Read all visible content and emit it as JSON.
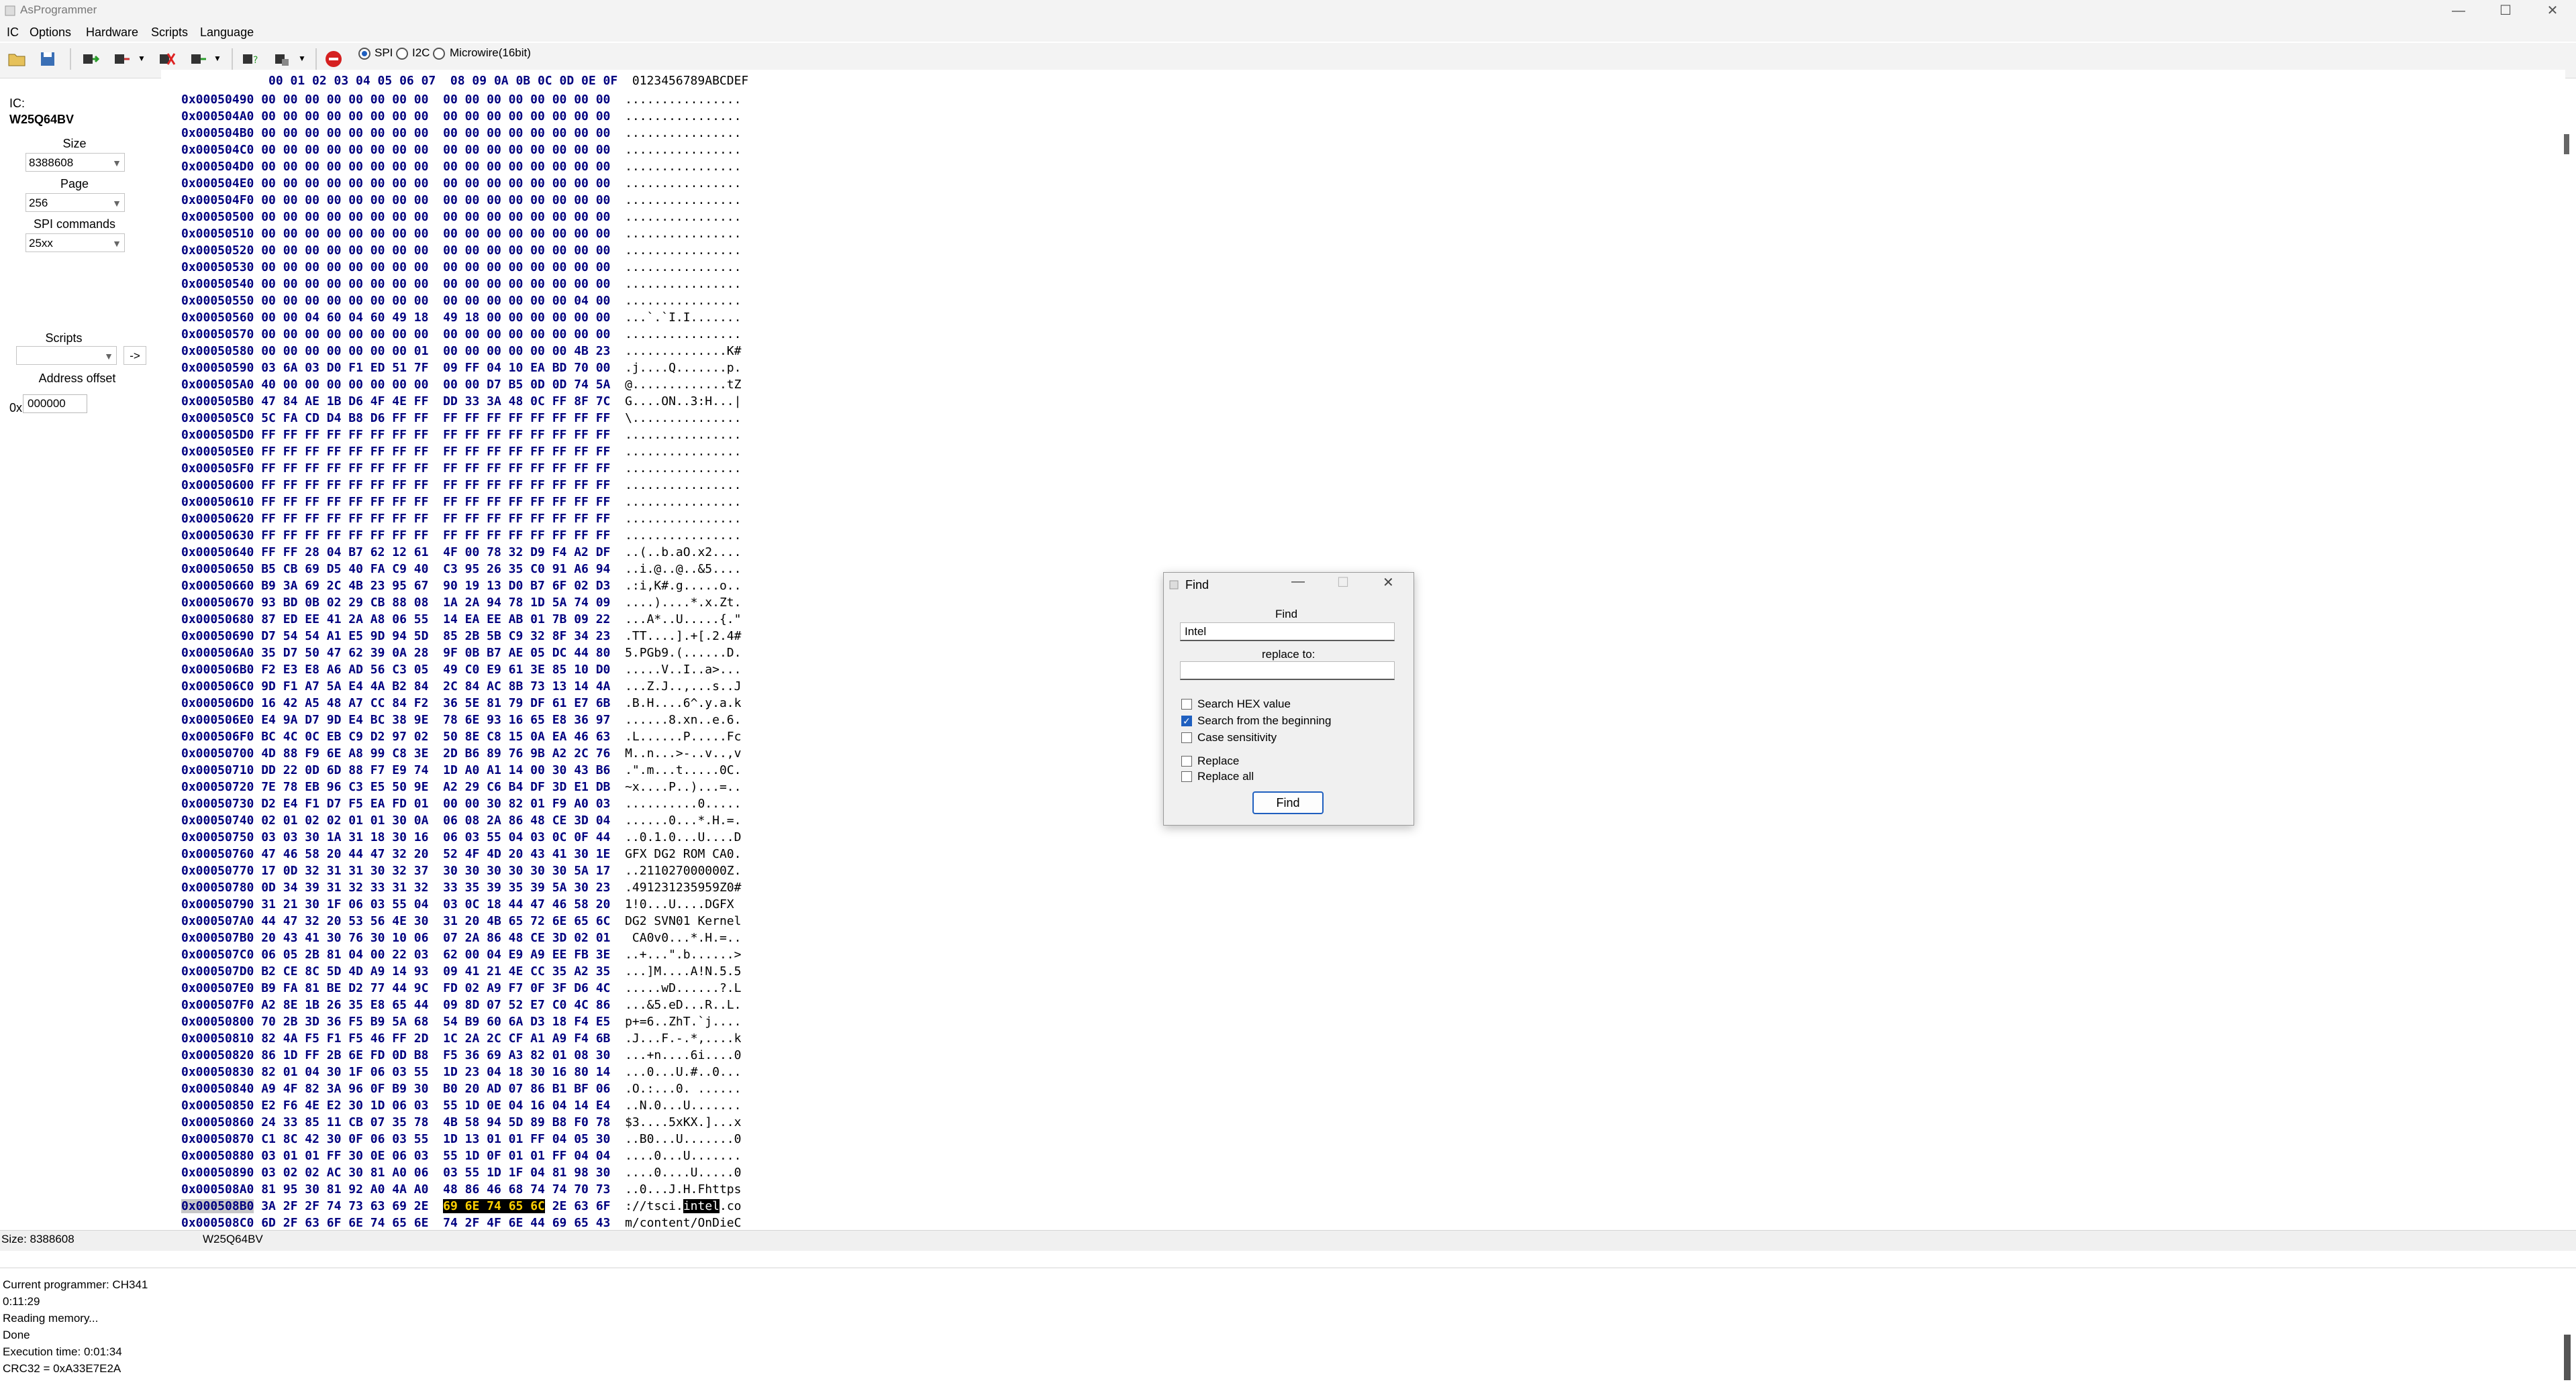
{
  "window": {
    "title": "AsProgrammer",
    "min": "—",
    "max": "☐",
    "close": "✕"
  },
  "menu": [
    "IC",
    "Options",
    "Hardware",
    "Scripts",
    "Language"
  ],
  "toolbar": {
    "protocols": [
      "SPI",
      "I2C",
      "Microwire(16bit)"
    ],
    "selected_protocol": "SPI"
  },
  "left_panel": {
    "ic_label": "IC:",
    "ic_name": "W25Q64BV",
    "size_label": "Size",
    "size_value": "8388608",
    "page_label": "Page",
    "page_value": "256",
    "spi_label": "SPI commands",
    "spi_value": "25xx",
    "scripts_label": "Scripts",
    "scripts_value": "",
    "run_label": "->",
    "addr_label": "Address offset",
    "addr_prefix": "0x",
    "addr_value": "000000"
  },
  "hex": {
    "header": "00 01 02 03 04 05 06 07  08 09 0A 0B 0C 0D 0E 0F",
    "ascii_header": "0123456789ABCDEF",
    "rows": [
      {
        "a": "0x00050490",
        "b": "00 00 00 00 00 00 00 00  00 00 00 00 00 00 00 00",
        "t": "................"
      },
      {
        "a": "0x000504A0",
        "b": "00 00 00 00 00 00 00 00  00 00 00 00 00 00 00 00",
        "t": "................"
      },
      {
        "a": "0x000504B0",
        "b": "00 00 00 00 00 00 00 00  00 00 00 00 00 00 00 00",
        "t": "................"
      },
      {
        "a": "0x000504C0",
        "b": "00 00 00 00 00 00 00 00  00 00 00 00 00 00 00 00",
        "t": "................"
      },
      {
        "a": "0x000504D0",
        "b": "00 00 00 00 00 00 00 00  00 00 00 00 00 00 00 00",
        "t": "................"
      },
      {
        "a": "0x000504E0",
        "b": "00 00 00 00 00 00 00 00  00 00 00 00 00 00 00 00",
        "t": "................"
      },
      {
        "a": "0x000504F0",
        "b": "00 00 00 00 00 00 00 00  00 00 00 00 00 00 00 00",
        "t": "................"
      },
      {
        "a": "0x00050500",
        "b": "00 00 00 00 00 00 00 00  00 00 00 00 00 00 00 00",
        "t": "................"
      },
      {
        "a": "0x00050510",
        "b": "00 00 00 00 00 00 00 00  00 00 00 00 00 00 00 00",
        "t": "................"
      },
      {
        "a": "0x00050520",
        "b": "00 00 00 00 00 00 00 00  00 00 00 00 00 00 00 00",
        "t": "................"
      },
      {
        "a": "0x00050530",
        "b": "00 00 00 00 00 00 00 00  00 00 00 00 00 00 00 00",
        "t": "................"
      },
      {
        "a": "0x00050540",
        "b": "00 00 00 00 00 00 00 00  00 00 00 00 00 00 00 00",
        "t": "................"
      },
      {
        "a": "0x00050550",
        "b": "00 00 00 00 00 00 00 00  00 00 00 00 00 00 04 00",
        "t": "................"
      },
      {
        "a": "0x00050560",
        "b": "00 00 04 60 04 60 49 18  49 18 00 00 00 00 00 00",
        "t": "...`.`I.I......."
      },
      {
        "a": "0x00050570",
        "b": "00 00 00 00 00 00 00 00  00 00 00 00 00 00 00 00",
        "t": "................"
      },
      {
        "a": "0x00050580",
        "b": "00 00 00 00 00 00 00 01  00 00 00 00 00 00 4B 23",
        "t": "..............K#"
      },
      {
        "a": "0x00050590",
        "b": "03 6A 03 D0 F1 ED 51 7F  09 FF 04 10 EA BD 70 00",
        "t": ".j....Q.......p."
      },
      {
        "a": "0x000505A0",
        "b": "40 00 00 00 00 00 00 00  00 00 D7 B5 0D 0D 74 5A",
        "t": "@.............tZ"
      },
      {
        "a": "0x000505B0",
        "b": "47 84 AE 1B D6 4F 4E FF  DD 33 3A 48 0C FF 8F 7C",
        "t": "G....ON..3:H...|"
      },
      {
        "a": "0x000505C0",
        "b": "5C FA CD D4 B8 D6 FF FF  FF FF FF FF FF FF FF FF",
        "t": "\\..............."
      },
      {
        "a": "0x000505D0",
        "b": "FF FF FF FF FF FF FF FF  FF FF FF FF FF FF FF FF",
        "t": "................"
      },
      {
        "a": "0x000505E0",
        "b": "FF FF FF FF FF FF FF FF  FF FF FF FF FF FF FF FF",
        "t": "................"
      },
      {
        "a": "0x000505F0",
        "b": "FF FF FF FF FF FF FF FF  FF FF FF FF FF FF FF FF",
        "t": "................"
      },
      {
        "a": "0x00050600",
        "b": "FF FF FF FF FF FF FF FF  FF FF FF FF FF FF FF FF",
        "t": "................"
      },
      {
        "a": "0x00050610",
        "b": "FF FF FF FF FF FF FF FF  FF FF FF FF FF FF FF FF",
        "t": "................"
      },
      {
        "a": "0x00050620",
        "b": "FF FF FF FF FF FF FF FF  FF FF FF FF FF FF FF FF",
        "t": "................"
      },
      {
        "a": "0x00050630",
        "b": "FF FF FF FF FF FF FF FF  FF FF FF FF FF FF FF FF",
        "t": "................"
      },
      {
        "a": "0x00050640",
        "b": "FF FF 28 04 B7 62 12 61  4F 00 78 32 D9 F4 A2 DF",
        "t": "..(..b.aO.x2...."
      },
      {
        "a": "0x00050650",
        "b": "B5 CB 69 D5 40 FA C9 40  C3 95 26 35 C0 91 A6 94",
        "t": "..i.@..@..&5...."
      },
      {
        "a": "0x00050660",
        "b": "B9 3A 69 2C 4B 23 95 67  90 19 13 D0 B7 6F 02 D3",
        "t": ".:i,K#.g.....o.."
      },
      {
        "a": "0x00050670",
        "b": "93 BD 0B 02 29 CB 88 08  1A 2A 94 78 1D 5A 74 09",
        "t": "....)....*.x.Zt."
      },
      {
        "a": "0x00050680",
        "b": "87 ED EE 41 2A A8 06 55  14 EA EE AB 01 7B 09 22",
        "t": "...A*..U.....{.\""
      },
      {
        "a": "0x00050690",
        "b": "D7 54 54 A1 E5 9D 94 5D  85 2B 5B C9 32 8F 34 23",
        "t": ".TT....].+[.2.4#"
      },
      {
        "a": "0x000506A0",
        "b": "35 D7 50 47 62 39 0A 28  9F 0B B7 AE 05 DC 44 80",
        "t": "5.PGb9.(......D."
      },
      {
        "a": "0x000506B0",
        "b": "F2 E3 E8 A6 AD 56 C3 05  49 C0 E9 61 3E 85 10 D0",
        "t": ".....V..I..a>..."
      },
      {
        "a": "0x000506C0",
        "b": "9D F1 A7 5A E4 4A B2 84  2C 84 AC 8B 73 13 14 4A",
        "t": "...Z.J..,...s..J"
      },
      {
        "a": "0x000506D0",
        "b": "16 42 A5 48 A7 CC 84 F2  36 5E 81 79 DF 61 E7 6B",
        "t": ".B.H....6^.y.a.k"
      },
      {
        "a": "0x000506E0",
        "b": "E4 9A D7 9D E4 BC 38 9E  78 6E 93 16 65 E8 36 97",
        "t": "......8.xn..e.6."
      },
      {
        "a": "0x000506F0",
        "b": "BC 4C 0C EB C9 D2 97 02  50 8E C8 15 0A EA 46 63",
        "t": ".L......P.....Fc"
      },
      {
        "a": "0x00050700",
        "b": "4D 88 F9 6E A8 99 C8 3E  2D B6 89 76 9B A2 2C 76",
        "t": "M..n...>-..v..,v"
      },
      {
        "a": "0x00050710",
        "b": "DD 22 0D 6D 88 F7 E9 74  1D A0 A1 14 00 30 43 B6",
        "t": ".\".m...t.....0C."
      },
      {
        "a": "0x00050720",
        "b": "7E 78 EB 96 C3 E5 50 9E  A2 29 C6 B4 DF 3D E1 DB",
        "t": "~x....P..)...=.."
      },
      {
        "a": "0x00050730",
        "b": "D2 E4 F1 D7 F5 EA FD 01  00 00 30 82 01 F9 A0 03",
        "t": "..........0....."
      },
      {
        "a": "0x00050740",
        "b": "02 01 02 02 01 01 30 0A  06 08 2A 86 48 CE 3D 04",
        "t": "......0...*.H.=."
      },
      {
        "a": "0x00050750",
        "b": "03 03 30 1A 31 18 30 16  06 03 55 04 03 0C 0F 44",
        "t": "..0.1.0...U....D"
      },
      {
        "a": "0x00050760",
        "b": "47 46 58 20 44 47 32 20  52 4F 4D 20 43 41 30 1E",
        "t": "GFX DG2 ROM CA0."
      },
      {
        "a": "0x00050770",
        "b": "17 0D 32 31 31 30 32 37  30 30 30 30 30 30 5A 17",
        "t": "..211027000000Z."
      },
      {
        "a": "0x00050780",
        "b": "0D 34 39 31 32 33 31 32  33 35 39 35 39 5A 30 23",
        "t": ".491231235959Z0#"
      },
      {
        "a": "0x00050790",
        "b": "31 21 30 1F 06 03 55 04  03 0C 18 44 47 46 58 20",
        "t": "1!0...U....DGFX "
      },
      {
        "a": "0x000507A0",
        "b": "44 47 32 20 53 56 4E 30  31 20 4B 65 72 6E 65 6C",
        "t": "DG2 SVN01 Kernel"
      },
      {
        "a": "0x000507B0",
        "b": "20 43 41 30 76 30 10 06  07 2A 86 48 CE 3D 02 01",
        "t": " CA0v0...*.H.=.."
      },
      {
        "a": "0x000507C0",
        "b": "06 05 2B 81 04 00 22 03  62 00 04 E9 A9 EE FB 3E",
        "t": "..+...\".b......>"
      },
      {
        "a": "0x000507D0",
        "b": "B2 CE 8C 5D 4D A9 14 93  09 41 21 4E CC 35 A2 35",
        "t": "...]M....A!N.5.5"
      },
      {
        "a": "0x000507E0",
        "b": "B9 FA 81 BE D2 77 44 9C  FD 02 A9 F7 0F 3F D6 4C",
        "t": ".....wD......?.L"
      },
      {
        "a": "0x000507F0",
        "b": "A2 8E 1B 26 35 E8 65 44  09 8D 07 52 E7 C0 4C 86",
        "t": "...&5.eD...R..L."
      },
      {
        "a": "0x00050800",
        "b": "70 2B 3D 36 F5 B9 5A 68  54 B9 60 6A D3 18 F4 E5",
        "t": "p+=6..ZhT.`j...."
      },
      {
        "a": "0x00050810",
        "b": "82 4A F5 F1 F5 46 FF 2D  1C 2A 2C CF A1 A9 F4 6B",
        "t": ".J...F.-.*,....k"
      },
      {
        "a": "0x00050820",
        "b": "86 1D FF 2B 6E FD 0D B8  F5 36 69 A3 82 01 08 30",
        "t": "...+n....6i....0"
      },
      {
        "a": "0x00050830",
        "b": "82 01 04 30 1F 06 03 55  1D 23 04 18 30 16 80 14",
        "t": "...0...U.#..0..."
      },
      {
        "a": "0x00050840",
        "b": "A9 4F 82 3A 96 0F B9 30  B0 20 AD 07 86 B1 BF 06",
        "t": ".O.:...0. ......"
      },
      {
        "a": "0x00050850",
        "b": "E2 F6 4E E2 30 1D 06 03  55 1D 0E 04 16 04 14 E4",
        "t": "..N.0...U......."
      },
      {
        "a": "0x00050860",
        "b": "24 33 85 11 CB 07 35 78  4B 58 94 5D 89 B8 F0 78",
        "t": "$3....5xKX.]...x"
      },
      {
        "a": "0x00050870",
        "b": "C1 8C 42 30 0F 06 03 55  1D 13 01 01 FF 04 05 30",
        "t": "..B0...U.......0"
      },
      {
        "a": "0x00050880",
        "b": "03 01 01 FF 30 0E 06 03  55 1D 0F 01 01 FF 04 04",
        "t": "....0...U......."
      },
      {
        "a": "0x00050890",
        "b": "03 02 02 AC 30 81 A0 06  03 55 1D 1F 04 81 98 30",
        "t": "....0....U.....0"
      },
      {
        "a": "0x000508A0",
        "b": "81 95 30 81 92 A0 4A A0  48 86 46 68 74 74 70 73",
        "t": "..0...J.H.Fhttps"
      },
      {
        "a": "0x000508B0",
        "b1": "3A 2F 2F 74 73 63 69 2E  ",
        "hl": "69 6E 74 65 6C",
        "b2": " 2E 63 6F",
        "t1": "://tsci.",
        "thl": "intel",
        "t2": ".co",
        "selected": true
      },
      {
        "a": "0x000508C0",
        "b": "6D 2F 63 6F 6E 74 65 6E  74 2F 4F 6E 44 69 65 43",
        "t": "m/content/OnDieC"
      }
    ]
  },
  "status": {
    "size": "Size: 8388608",
    "chip": "W25Q64BV"
  },
  "log": [
    "Current programmer: CH341",
    "0:11:29",
    "Reading memory...",
    "Done",
    "Execution time: 0:01:34",
    "CRC32 = 0xA33E7E2A"
  ],
  "find_dialog": {
    "title": "Find",
    "find_label": "Find",
    "find_value": "Intel",
    "replace_label": "replace to:",
    "replace_value": "",
    "options": [
      {
        "label": "Search HEX value",
        "checked": false
      },
      {
        "label": "Search from the beginning",
        "checked": true
      },
      {
        "label": "Case sensitivity",
        "checked": false
      },
      {
        "label": "Replace",
        "checked": false
      },
      {
        "label": "Replace all",
        "checked": false
      }
    ],
    "button": "Find"
  }
}
